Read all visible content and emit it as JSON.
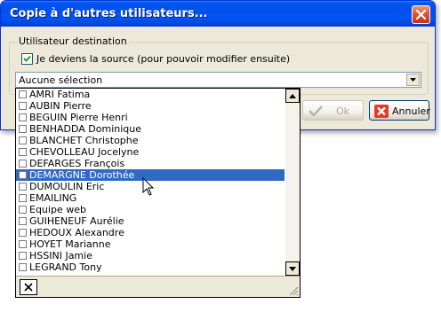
{
  "window": {
    "title": "Copie à d'autres utilisateurs..."
  },
  "group": {
    "legend": "Utilisateur destination",
    "source_checkbox": {
      "label": "Je deviens la source (pour pouvoir modifier ensuite)",
      "checked": true
    },
    "combo": {
      "value": "Aucune sélection"
    }
  },
  "buttons": {
    "ok_label": "Ok",
    "cancel_label": "Annuler"
  },
  "dropdown": {
    "items": [
      {
        "label": "AMRI Fatima",
        "selected": false
      },
      {
        "label": "AUBIN Pierre",
        "selected": false
      },
      {
        "label": "BEGUIN Pierre Henri",
        "selected": false
      },
      {
        "label": "BENHADDA Dominique",
        "selected": false
      },
      {
        "label": "BLANCHET Christophe",
        "selected": false
      },
      {
        "label": "CHEVOLLEAU  Jocelyne",
        "selected": false
      },
      {
        "label": "DEFARGES François",
        "selected": false
      },
      {
        "label": "DEMARGNE Dorothée",
        "selected": true
      },
      {
        "label": "DUMOULIN Eric",
        "selected": false
      },
      {
        "label": "EMAILING",
        "selected": false
      },
      {
        "label": "Equipe web",
        "selected": false
      },
      {
        "label": "GUIHENEUF Aurélie",
        "selected": false
      },
      {
        "label": "HEDOUX Alexandre",
        "selected": false
      },
      {
        "label": "HOYET Marianne",
        "selected": false
      },
      {
        "label": "HSSINI Jamie",
        "selected": false
      },
      {
        "label": "LEGRAND Tony",
        "selected": false
      }
    ]
  },
  "colors": {
    "titlebar": "#0054e3",
    "selection": "#316ac5",
    "dialog_face": "#ece9d8"
  }
}
